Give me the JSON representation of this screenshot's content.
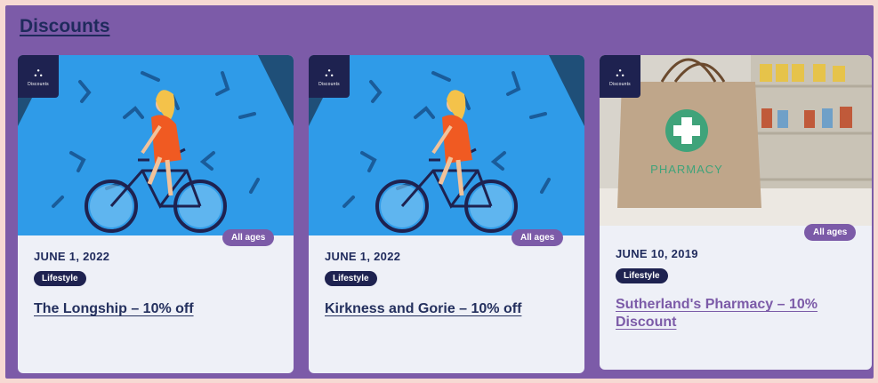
{
  "section": {
    "title": "Discounts"
  },
  "logo_text": "Discounts",
  "cards": [
    {
      "date": "JUNE 1, 2022",
      "category": "Lifestyle",
      "age": "All ages",
      "title": "The Longship – 10% off",
      "image": "cyclist-illustration"
    },
    {
      "date": "JUNE 1, 2022",
      "category": "Lifestyle",
      "age": "All ages",
      "title": "Kirkness and Gorie – 10% off",
      "image": "cyclist-illustration"
    },
    {
      "date": "JUNE 10, 2019",
      "category": "Lifestyle",
      "age": "All ages",
      "title": "Sutherland's Pharmacy – 10% Discount",
      "image": "pharmacy-bag-photo",
      "bag_text": "PHARMACY"
    }
  ],
  "colors": {
    "panel": "#7c5ba8",
    "navy": "#1e2250",
    "card": "#eef0f7",
    "sky": "#2f9be8",
    "pharmacy_green": "#3fa37a"
  }
}
